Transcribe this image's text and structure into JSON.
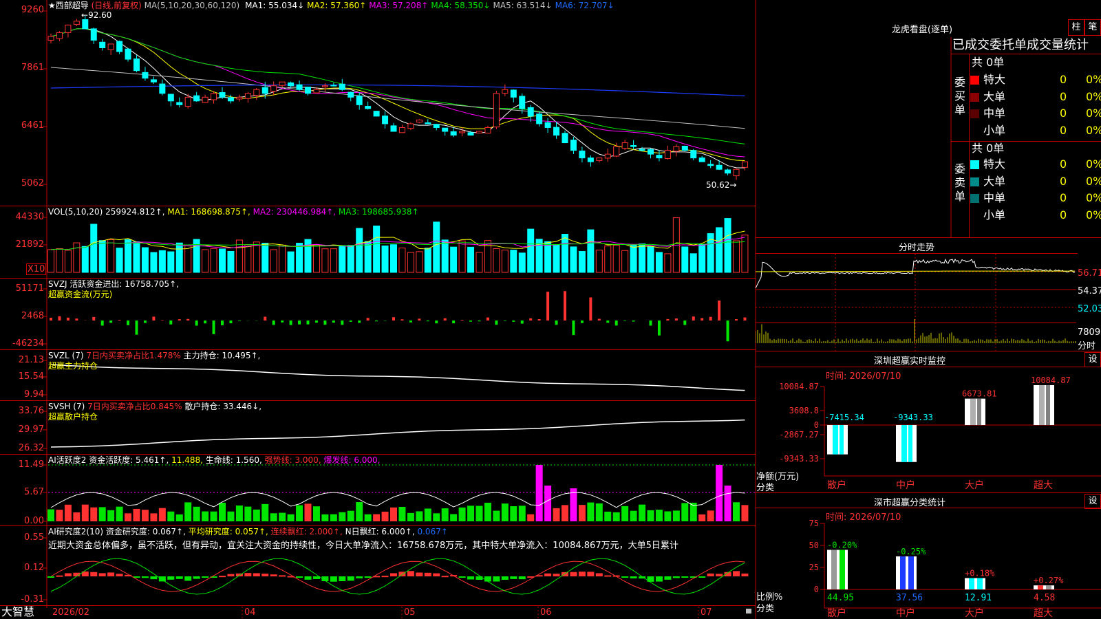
{
  "stock": {
    "title": "★西部超导",
    "period": "(日线,前复权)",
    "ma_label": "MA(5,10,20,30,60,120)",
    "ma": [
      {
        "label": "MA1:",
        "value": "55.034↓",
        "color": "#ffffff"
      },
      {
        "label": "MA2:",
        "value": "57.360↑",
        "color": "#ffff00"
      },
      {
        "label": "MA3:",
        "value": "57.208↑",
        "color": "#ff00ff"
      },
      {
        "label": "MA4:",
        "value": "58.350↓",
        "color": "#00e600"
      },
      {
        "label": "MA5:",
        "value": "63.514↓",
        "color": "#c0c0c0"
      },
      {
        "label": "MA6:",
        "value": "72.707↓",
        "color": "#1e6bff"
      }
    ],
    "high_mark": "92.60",
    "low_mark": "50.62",
    "yaxis": [
      "9260",
      "7861",
      "6461",
      "5062"
    ]
  },
  "volume": {
    "header": "VOL(5,10,20)",
    "val": "259924.812↑,",
    "ma1": "MA1: 168698.875↑,",
    "ma2": "MA2: 230446.984↑,",
    "ma3": "MA3: 198685.938↑",
    "yaxis": [
      "44330",
      "21892"
    ],
    "unit": "X10"
  },
  "svzj": {
    "header": "SVZJ  活跃资金进出: 16758.705↑,",
    "sub": "超赢资金流(万元)",
    "yaxis": [
      "51171",
      "2468",
      "-46234"
    ]
  },
  "svzl": {
    "header1": "SVZL (7)",
    "header2": "7日内买卖净占比1.478%",
    "header3": "主力持仓: 10.495↑,",
    "sub": "超赢主力持仓",
    "yaxis": [
      "21.13",
      "15.54",
      "9.94"
    ]
  },
  "svsh": {
    "header1": "SVSH (7)",
    "header2": "7日内买卖净占比0.845%",
    "header3": "散户持仓: 33.446↓,",
    "sub": "超赢散户持仓",
    "yaxis": [
      "33.76",
      "29.97",
      "26.32"
    ]
  },
  "ai1": {
    "h1": "AI活跃度2 资金活跃度: 5.461↑,",
    "h2": "11.488,",
    "h3": "生命线: 1.560,",
    "h4": "强势线: 3.000,",
    "h5": "爆发线: 6.000,",
    "yaxis": [
      "11.49",
      "5.67",
      "0.00"
    ]
  },
  "ai2": {
    "h1": "AI研究度2(10) 资金研究度: 0.067↑,",
    "h2": "平均研究度: 0.057↑,",
    "h3": "连续飘红: 2.000↑,",
    "h4": "N日飘红: 6.000↑,",
    "h5": "0.067↑",
    "comment": "近期大资金总体偏多，虽不活跃，但有异动，宜关注大资金的持续性，今日大单净流入：16758.678万元，其中特大单净流入：10084.867万元，大单5日累计",
    "yaxis": [
      "0.55",
      "0.12",
      "-0.31"
    ]
  },
  "xaxis": {
    "app": "大智慧",
    "labels": [
      "2026/02",
      "04",
      "05",
      "06",
      "07"
    ]
  },
  "right": {
    "lhb_title": "龙虎看盘(逐单)",
    "btn_zhu": "柱",
    "btn_bi": "笔",
    "table_title": "已成交委托单成交量统计",
    "buy_label": "委买单",
    "sell_label": "委卖单",
    "buy_total": "共 0单",
    "sell_total": "共 0单",
    "buy_rows": [
      {
        "name": "特大",
        "count": "0",
        "pct": "0%",
        "color": "#ff0000"
      },
      {
        "name": "大单",
        "count": "0",
        "pct": "0%",
        "color": "#8b0000"
      },
      {
        "name": "中单",
        "count": "0",
        "pct": "0%",
        "color": "#5a0000"
      },
      {
        "name": "小单",
        "count": "0",
        "pct": "0%",
        "color": "#000000"
      }
    ],
    "sell_rows": [
      {
        "name": "特大",
        "count": "0",
        "pct": "0%",
        "color": "#00ffff"
      },
      {
        "name": "大单",
        "count": "0",
        "pct": "0%",
        "color": "#008b8b"
      },
      {
        "name": "中单",
        "count": "0",
        "pct": "0%",
        "color": "#007070"
      },
      {
        "name": "小单",
        "count": "0",
        "pct": "0%",
        "color": "#000000"
      }
    ],
    "fs_title": "分时走势",
    "fs_yaxis": [
      "56.71",
      "54.37",
      "52.03"
    ],
    "fs_vol": "7809",
    "fs_vol_unit": "分时",
    "sz_title": "深圳超赢实时监控",
    "sz_btn": "设",
    "sz_time": "时间: 2026/07/10",
    "sz_yaxis": [
      "10084.87",
      "3608.8",
      "0",
      "-2867.27",
      "-9343.33"
    ],
    "sz_unit1": "净额(万元)",
    "sz_unit2": "分类",
    "sz_categories": [
      "散户",
      "中户",
      "大户",
      "超大"
    ],
    "sz_bar_labels": [
      "-7415.34",
      "-9343.33",
      "6673.81",
      "10084.87"
    ],
    "sz_values": [
      -7415.34,
      -9343.33,
      6673.81,
      10084.87
    ],
    "fl_title": "深市超赢分类统计",
    "fl_btn": "设",
    "fl_time": "时间: 2026/07/10",
    "fl_yaxis": [
      "75",
      "50",
      "25",
      "0"
    ],
    "fl_unit1": "比例%",
    "fl_unit2": "分类",
    "fl_categories": [
      "散户",
      "中户",
      "大户",
      "超大"
    ],
    "fl_changes": [
      "-0.20%",
      "-0.25%",
      "+0.18%",
      "+0.27%"
    ],
    "fl_values": [
      "44.95",
      "37.56",
      "12.91",
      "4.58"
    ],
    "fl_nums": [
      44.95,
      37.56,
      12.91,
      4.58
    ]
  }
}
